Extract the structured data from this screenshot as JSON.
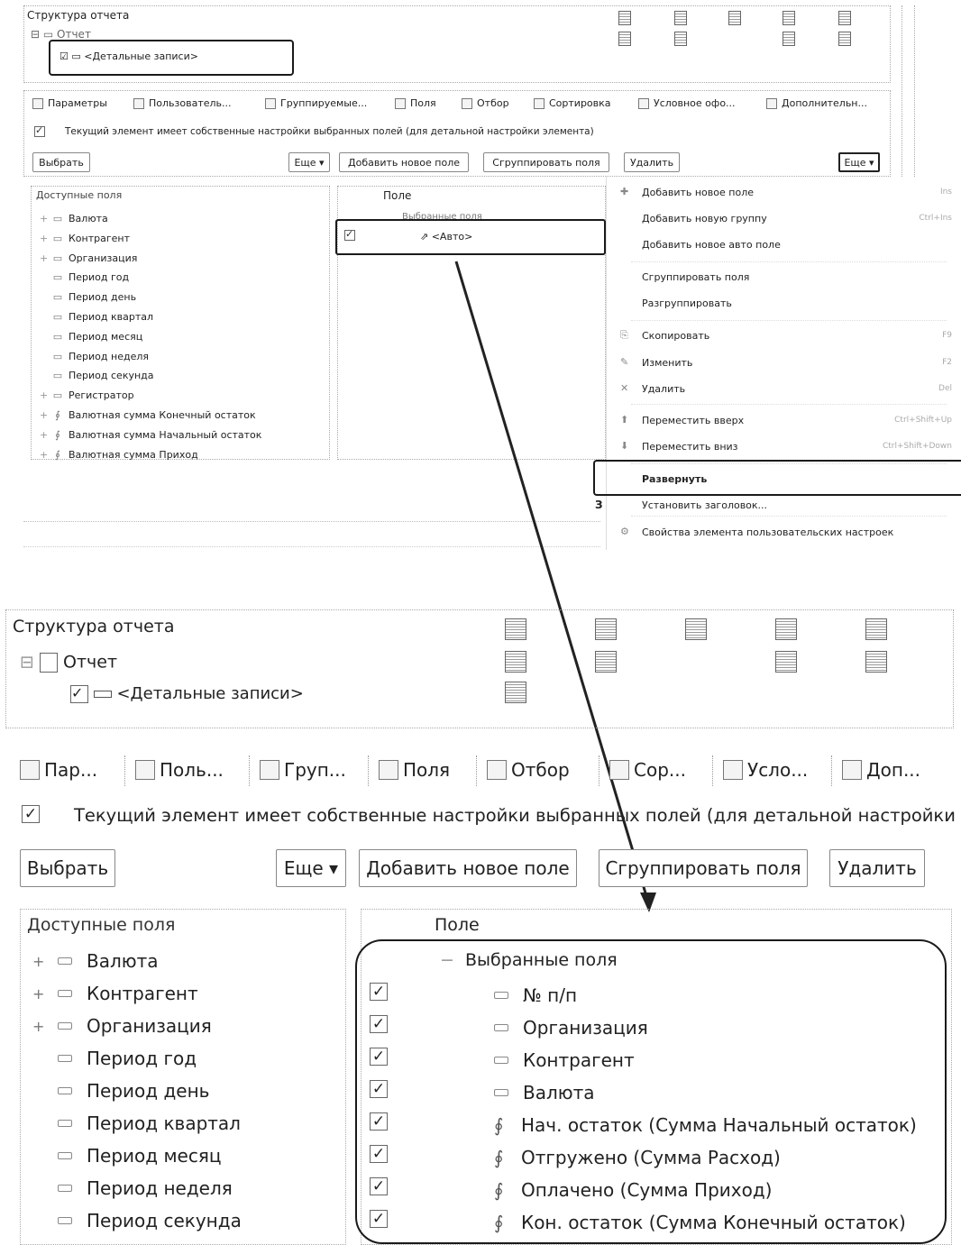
{
  "top": {
    "structure_title": "Структура отчета",
    "report_node": "Отчет",
    "detail_records": "<Детальные записи>",
    "tabs": [
      "Параметры",
      "Пользователь...",
      "Группируемые...",
      "Поля",
      "Отбор",
      "Сортировка",
      "Условное офо...",
      "Дополнительн..."
    ],
    "own_settings_text": "Текущий элемент имеет собственные настройки выбранных полей (для детальной настройки элемента)",
    "buttons": {
      "select": "Выбрать",
      "more": "Еще",
      "add_field": "Добавить новое поле",
      "group_fields": "Сгруппировать поля",
      "delete": "Удалить",
      "more2": "Еще"
    },
    "available_fields_header": "Доступные поля",
    "available_fields": [
      "Валюта",
      "Контрагент",
      "Организация",
      "Период год",
      "Период день",
      "Период квартал",
      "Период месяц",
      "Период неделя",
      "Период секунда",
      "Регистратор",
      "Валютная сумма Конечный остаток",
      "Валютная сумма Начальный остаток",
      "Валютная сумма Приход"
    ],
    "field_header": "Поле",
    "selected_fields_label": "Выбранные поля",
    "auto_field": "<Авто>"
  },
  "context_menu": {
    "items": [
      {
        "label": "Добавить новое поле",
        "shortcut": "Ins"
      },
      {
        "label": "Добавить новую группу",
        "shortcut": "Ctrl+Ins"
      },
      {
        "label": "Добавить новое авто поле",
        "shortcut": ""
      },
      {
        "label": "Сгруппировать поля",
        "shortcut": ""
      },
      {
        "label": "Разгруппировать",
        "shortcut": ""
      },
      {
        "label": "Скопировать",
        "shortcut": "F9"
      },
      {
        "label": "Изменить",
        "shortcut": "F2"
      },
      {
        "label": "Удалить",
        "shortcut": "Del"
      },
      {
        "label": "Переместить вверх",
        "shortcut": "Ctrl+Shift+Up"
      },
      {
        "label": "Переместить вниз",
        "shortcut": "Ctrl+Shift+Down"
      },
      {
        "label": "Развернуть",
        "shortcut": ""
      },
      {
        "label": "Установить заголовок...",
        "shortcut": ""
      },
      {
        "label": "Свойства элемента пользовательских настроек",
        "shortcut": ""
      }
    ]
  },
  "bottom": {
    "structure_title": "Структура отчета",
    "report_node": "Отчет",
    "detail_records": "<Детальные записи>",
    "tabs": [
      "Пар...",
      "Поль...",
      "Груп...",
      "Поля",
      "Отбор",
      "Сор...",
      "Усло...",
      "Доп..."
    ],
    "own_settings_text": "Текущий элемент имеет собственные настройки выбранных полей (для детальной настройки",
    "buttons": {
      "select": "Выбрать",
      "more": "Еще",
      "add_field": "Добавить новое поле",
      "group_fields": "Сгруппировать поля",
      "delete": "Удалить"
    },
    "available_fields_header": "Доступные поля",
    "available_fields": [
      "Валюта",
      "Контрагент",
      "Организация",
      "Период год",
      "Период день",
      "Период квартал",
      "Период месяц",
      "Период неделя",
      "Период секунда"
    ],
    "field_header": "Поле",
    "selected_fields_label": "Выбранные поля",
    "selected_fields": [
      "№ п/п",
      "Организация",
      "Контрагент",
      "Валюта",
      "Нач. остаток (Сумма Начальный остаток)",
      "Отгружено (Сумма Расход)",
      "Оплачено (Сумма Приход)",
      "Кон. остаток (Сумма Конечный остаток)"
    ]
  }
}
